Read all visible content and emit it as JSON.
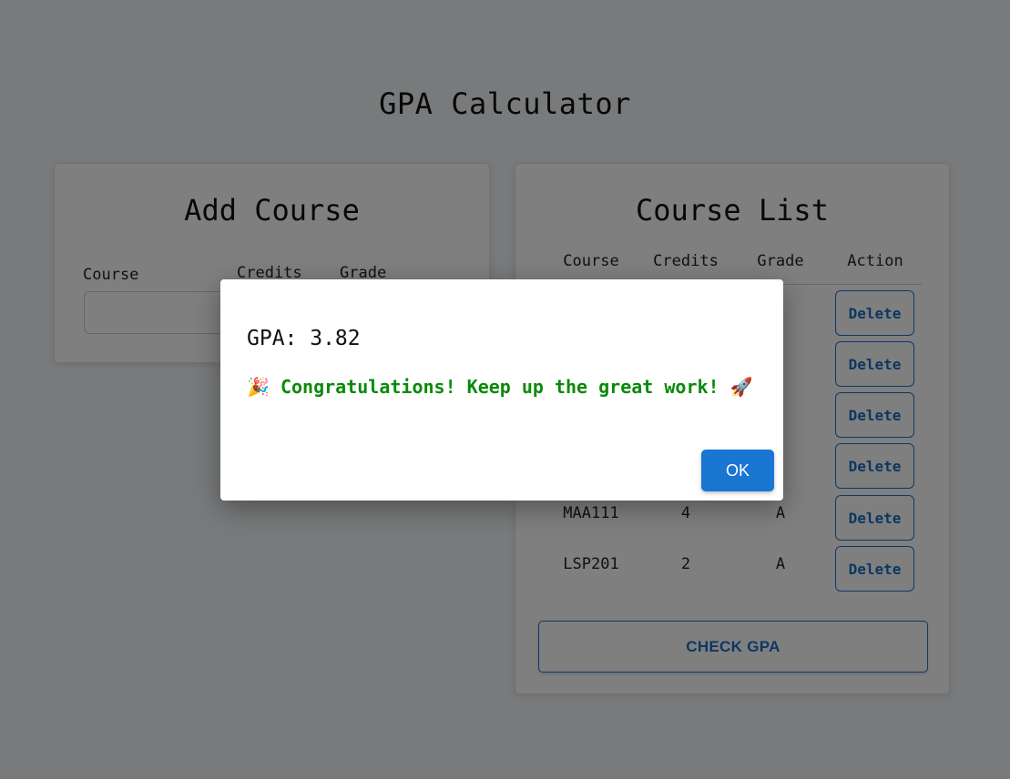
{
  "page": {
    "title": "GPA Calculator"
  },
  "add_course": {
    "title": "Add Course",
    "labels": {
      "course": "Course",
      "credits": "Credits",
      "grade": "Grade"
    },
    "course_input": {
      "value": "",
      "placeholder": ""
    }
  },
  "course_list": {
    "title": "Course List",
    "headers": [
      "Course",
      "Credits",
      "Grade",
      "Action"
    ],
    "rows": [
      {
        "course": "",
        "credits": "",
        "grade": "",
        "action": "Delete"
      },
      {
        "course": "",
        "credits": "",
        "grade": "",
        "action": "Delete"
      },
      {
        "course": "",
        "credits": "",
        "grade": "",
        "action": "Delete"
      },
      {
        "course": "",
        "credits": "",
        "grade": "",
        "action": "Delete"
      },
      {
        "course": "MAA111",
        "credits": "4",
        "grade": "A",
        "action": "Delete"
      },
      {
        "course": "LSP201",
        "credits": "2",
        "grade": "A",
        "action": "Delete"
      }
    ],
    "check_button": "CHECK GPA"
  },
  "dialog": {
    "gpa_text": "GPA: 3.82",
    "party_emoji": "🎉",
    "message": "Congratulations! Keep up the great work!",
    "rocket_emoji": "🚀",
    "ok_button": "OK"
  },
  "colors": {
    "accent": "#1976d2",
    "success": "#0a8a0a",
    "background": "#f1f4f7",
    "overlay": "rgba(0,0,0,0.5)"
  }
}
